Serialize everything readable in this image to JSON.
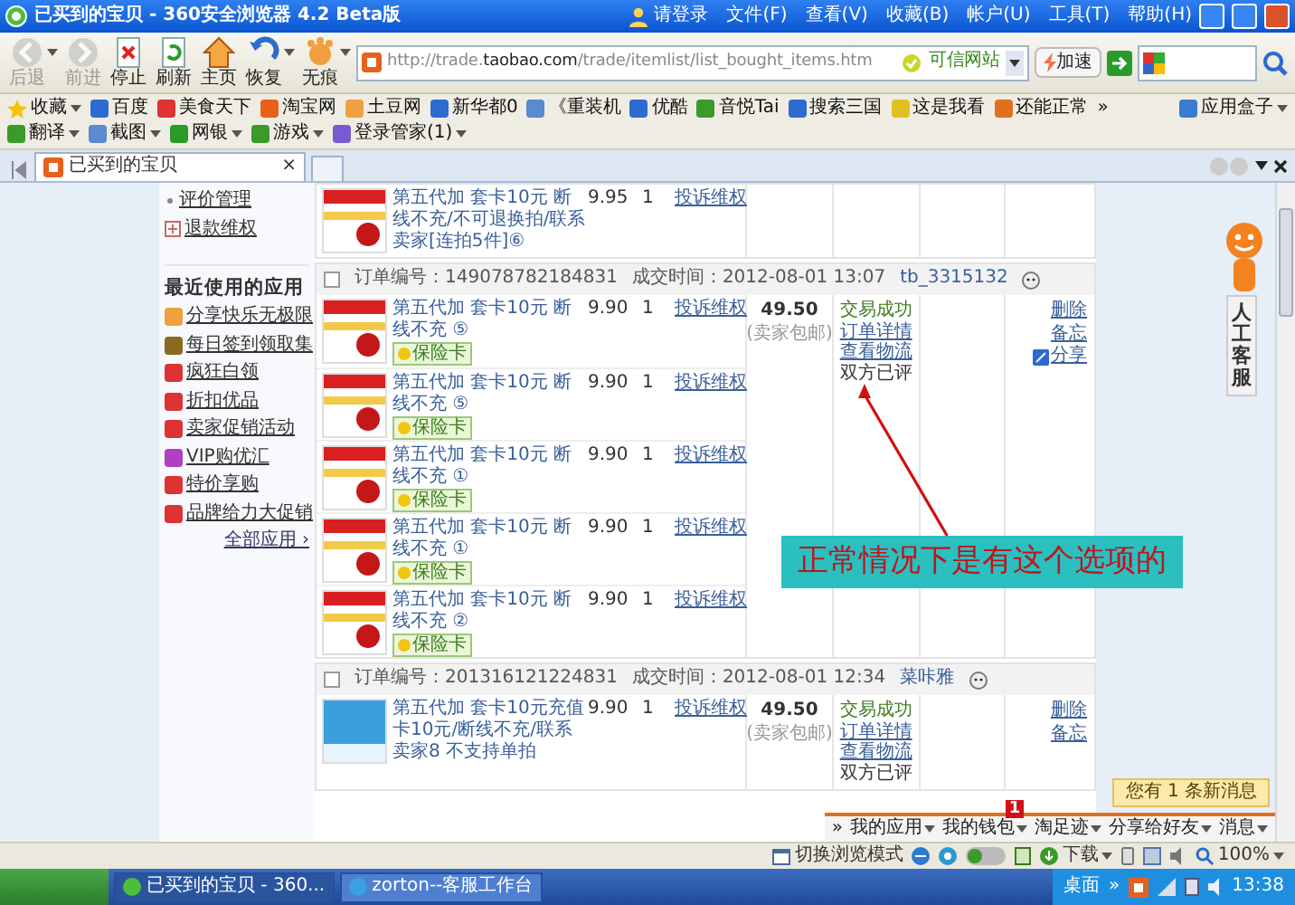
{
  "window": {
    "title": "已买到的宝贝 - 360安全浏览器 4.2 Beta版",
    "login": "请登录",
    "menu": [
      "文件(F)",
      "查看(V)",
      "收藏(B)",
      "帐户(U)",
      "工具(T)",
      "帮助(H)"
    ]
  },
  "toolbar": {
    "buttons": [
      {
        "kind": "back",
        "label": "后退",
        "disabled": true,
        "has_menu": true
      },
      {
        "kind": "forward",
        "label": "前进",
        "disabled": true,
        "has_menu": false
      },
      {
        "kind": "stop",
        "label": "停止",
        "disabled": false,
        "has_menu": false
      },
      {
        "kind": "refresh",
        "label": "刷新",
        "disabled": false,
        "has_menu": false
      },
      {
        "kind": "home",
        "label": "主页",
        "disabled": false,
        "has_menu": false
      },
      {
        "kind": "restore",
        "label": "恢复",
        "disabled": false,
        "has_menu": true
      },
      {
        "kind": "private",
        "label": "无痕",
        "disabled": false,
        "has_menu": true
      }
    ],
    "address": {
      "prefix": "http://trade.",
      "domain": "taobao.com",
      "path": "/trade/itemlist/list_bought_items.htm"
    },
    "trusted": "可信网站",
    "speedup": "加速"
  },
  "favorites": {
    "menu_label": "收藏",
    "items": [
      "百度",
      "美食天下",
      "淘宝网",
      "土豆网",
      "新华都0",
      "《重装机",
      "优酷",
      "音悦Tai",
      "搜索三国",
      "这是我看",
      "还能正常"
    ],
    "more": "»",
    "tools": [
      "应用盒子",
      "翻译",
      "截图",
      "网银",
      "游戏",
      "登录管家(1)"
    ]
  },
  "tabs": [
    {
      "label": "已买到的宝贝",
      "selected": true,
      "close": "×"
    }
  ],
  "sidebar": {
    "manage": [
      {
        "kind": "bullet",
        "label": "评价管理"
      },
      {
        "kind": "plus",
        "label": "退款维权"
      }
    ],
    "apps_heading": "最近使用的应用",
    "apps": [
      "分享快乐无极限",
      "每日签到领取集",
      "疯狂白领",
      "折扣优品",
      "卖家促销活动",
      "VIP购优汇",
      "特价享购",
      "品牌给力大促销"
    ],
    "all_apps": "全部应用 ›"
  },
  "orders": [
    {
      "items": [
        {
          "kind": "promo",
          "title": "第五代加 套卡10元 断线不充/不可退换拍/联系卖家[连拍5件]⑥",
          "price": "9.95",
          "qty": "1",
          "action": "投诉维权"
        }
      ]
    },
    {
      "checked": false,
      "number": "订单编号：149078782184831",
      "time": "成交时间：2012-08-01 13:07",
      "seller": "tb_3315132",
      "items": [
        {
          "kind": "promo",
          "title": "第五代加 套卡10元 断线不充 ⑤",
          "badge": "保险卡",
          "price": "9.90",
          "qty": "1",
          "action": "投诉维权"
        },
        {
          "kind": "promo",
          "title": "第五代加 套卡10元 断线不充 ⑤",
          "badge": "保险卡",
          "price": "9.90",
          "qty": "1",
          "action": "投诉维权"
        },
        {
          "kind": "promo",
          "title": "第五代加 套卡10元 断线不充 ①",
          "badge": "保险卡",
          "price": "9.90",
          "qty": "1",
          "action": "投诉维权"
        },
        {
          "kind": "promo",
          "title": "第五代加 套卡10元 断线不充 ①",
          "badge": "保险卡",
          "price": "9.90",
          "qty": "1",
          "action": "投诉维权"
        },
        {
          "kind": "promo",
          "title": "第五代加 套卡10元 断线不充 ②",
          "badge": "保险卡",
          "price": "9.90",
          "qty": "1",
          "action": "投诉维权"
        }
      ],
      "total": "49.50",
      "shipping": "(卖家包邮)",
      "status": [
        "交易成功",
        "订单详情",
        "查看物流",
        "双方已评"
      ],
      "actions": [
        "删除",
        "备忘",
        "分享"
      ]
    },
    {
      "checked": false,
      "number": "订单编号：201316121224831",
      "time": "成交时间：2012-08-01 12:34",
      "seller": "菜咔雅",
      "items": [
        {
          "kind": "topup",
          "title": "第五代加 套卡10元充值卡10元/断线不充/联系卖家8 不支持单拍",
          "price": "9.90",
          "qty": "1",
          "action": "投诉维权"
        }
      ],
      "total": "49.50",
      "shipping": "(卖家包邮)",
      "status": [
        "交易成功",
        "订单详情",
        "查看物流",
        "双方已评"
      ],
      "actions": [
        "删除",
        "备忘"
      ]
    }
  ],
  "annotation": {
    "text": "正常情况下是有这个选项的"
  },
  "service": {
    "label": "人工客服"
  },
  "notification": {
    "message": "您有 1 条新消息",
    "badge": "1",
    "more": "»",
    "links": [
      "我的应用",
      "我的钱包",
      "淘足迹",
      "分享给好友",
      "消息"
    ]
  },
  "status_bar": {
    "mode": "切换浏览模式",
    "download": "下载",
    "zoom": "100%"
  },
  "taskbar": {
    "tasks": [
      {
        "label": "已买到的宝贝 - 360...",
        "selected": true
      },
      {
        "label": "zorton--客服工作台",
        "selected": false
      }
    ],
    "desktop": "桌面",
    "more": "»",
    "clock": "13:38"
  }
}
